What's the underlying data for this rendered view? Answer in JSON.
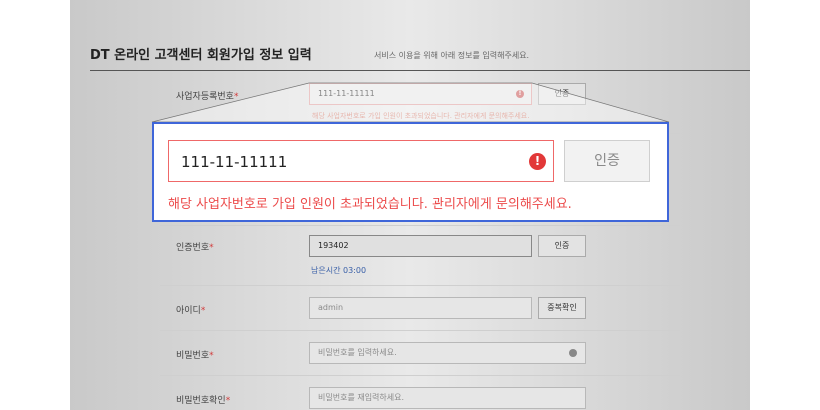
{
  "form": {
    "title": "DT 온라인 고객센터 회원가입 정보 입력",
    "subtitle": "서비스 이용을 위해 아래 정보를 입력해주세요."
  },
  "business_number": {
    "label": "사업자등록번호",
    "required_mark": "*",
    "value": "111-11-11111",
    "button": "인증",
    "error": "해당 사업자번호로 가입 인원이 초과되었습니다. 관리자에게 문의해주세요."
  },
  "auth_code": {
    "label": "인증번호",
    "required_mark": "*",
    "value": "193402",
    "button": "인증",
    "timer": "남은시간 03:00"
  },
  "user_id": {
    "label": "아이디",
    "required_mark": "*",
    "value": "admin",
    "button": "중복확인"
  },
  "password": {
    "label": "비밀번호",
    "required_mark": "*",
    "placeholder": "비밀번호를 입력하세요."
  },
  "password_confirm": {
    "label": "비밀번호확인",
    "required_mark": "*",
    "placeholder": "비밀번호를 재입력하세요."
  },
  "zoom": {
    "value": "111-11-11111",
    "error_icon": "!",
    "button": "인증",
    "error": "해당 사업자번호로 가입 인원이 초과되었습니다. 관리자에게 문의해주세요."
  },
  "icons": {
    "error": "exclamation-circle-icon",
    "password_visibility": "eye-icon"
  },
  "colors": {
    "error": "#ec4b4b",
    "focus_frame": "#3f66d9",
    "timer": "#3a60a8"
  }
}
